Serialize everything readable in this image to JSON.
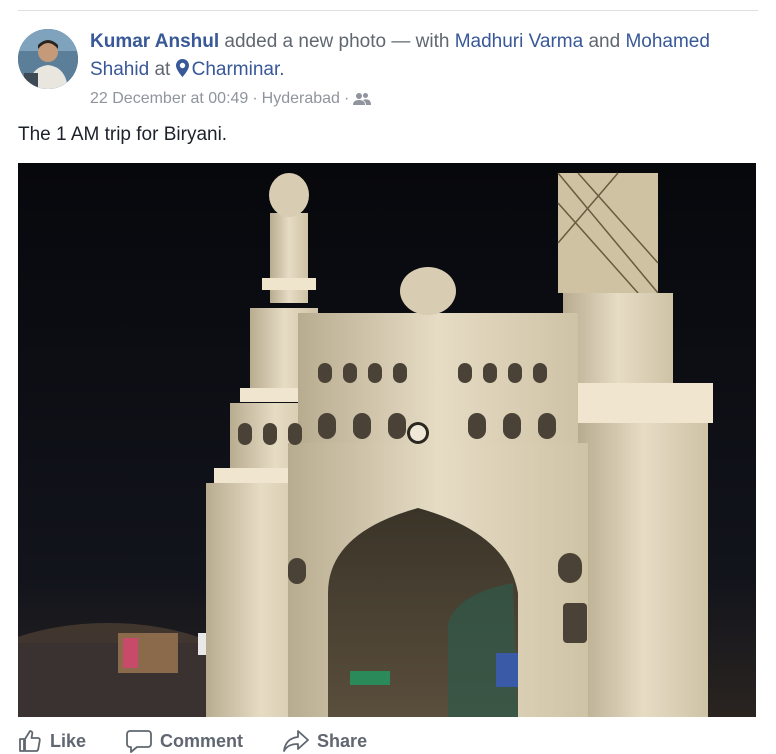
{
  "post": {
    "author": "Kumar Anshul",
    "action_text": "added a new photo",
    "with_text": "— with",
    "tagged_1": "Madhuri Varma",
    "and_text": "and",
    "tagged_2": "Mohamed Shahid",
    "at_text": "at",
    "location": "Charminar.",
    "timestamp": "22 December at 00:49",
    "sep_1": "·",
    "place": "Hyderabad",
    "sep_2": "·",
    "audience_icon": "friends-icon",
    "caption": "The 1 AM trip for Biryani.",
    "photo_icon": "charminar-night-photo"
  },
  "actions": {
    "like": "Like",
    "comment": "Comment",
    "share": "Share"
  },
  "colors": {
    "link": "#385898",
    "meta": "#90949c",
    "text": "#1d2129"
  }
}
